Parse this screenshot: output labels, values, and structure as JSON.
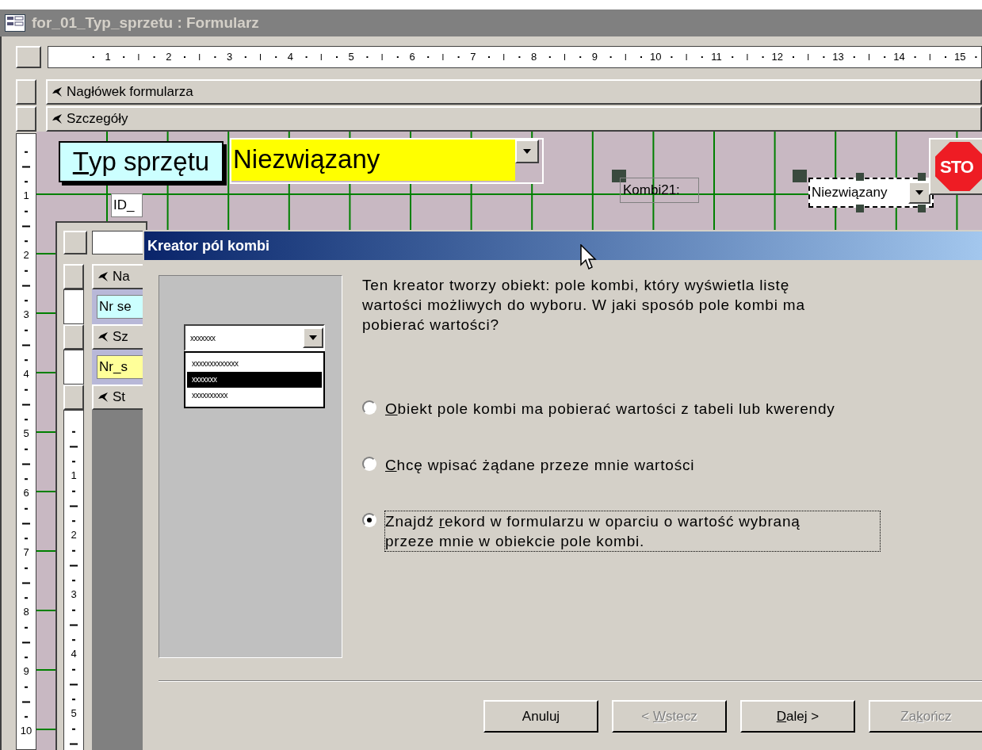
{
  "window": {
    "title": "for_01_Typ_sprzetu : Formularz"
  },
  "ruler": {
    "horizontal": [
      "1",
      "2",
      "3",
      "4",
      "5",
      "6",
      "7",
      "8",
      "9",
      "10",
      "11",
      "12",
      "13",
      "14",
      "15"
    ],
    "vertical": [
      "1",
      "2",
      "3",
      "4",
      "5",
      "6",
      "7",
      "8",
      "9",
      "10"
    ]
  },
  "sections": [
    {
      "label": "Nagłówek formularza"
    },
    {
      "label": "Szczegóły"
    }
  ],
  "detail": {
    "label": {
      "key": "T",
      "post": "yp sprzętu"
    },
    "combo": {
      "value": "Niezwiązany"
    },
    "id_field": "ID_",
    "kombi_label": "Kombi21:",
    "kombi_combo": {
      "value": "Niezwiązany",
      "selected": true
    },
    "stop_button": "STO"
  },
  "subform": {
    "ruler_vertical": [
      "1",
      "2",
      "3",
      "4",
      "5"
    ],
    "sections": [
      {
        "label": "Na",
        "field": {
          "text": "Nr se",
          "color": "#ccffff"
        }
      },
      {
        "label": "Sz",
        "field": {
          "text": "Nr_s",
          "color": "#ffff99"
        }
      },
      {
        "label": "St"
      }
    ]
  },
  "dialog": {
    "title": "Kreator pól kombi",
    "intro": "Ten kreator tworzy obiekt: pole kombi, który wyświetla listę wartości możliwych do wyboru. W jaki sposób pole kombi ma pobierać wartości?",
    "preview": {
      "value": "xxxxxxx",
      "items": [
        {
          "text": "xxxxxxxxxxxxx",
          "selected": false
        },
        {
          "text": "xxxxxxx",
          "selected": true
        },
        {
          "text": "xxxxxxxxxx",
          "selected": false
        }
      ]
    },
    "options": [
      {
        "key": "O",
        "post": "biekt pole kombi ma pobierać wartości z tabeli lub kwerendy",
        "selected": false,
        "focused": false
      },
      {
        "key": "C",
        "post": "hcę wpisać żądane przeze mnie wartości",
        "selected": false,
        "focused": false
      },
      {
        "pre": "Znajdź ",
        "key": "r",
        "post": "ekord w formularzu w oparciu o wartość wybraną przeze mnie w obiekcie pole kombi.",
        "selected": true,
        "focused": true
      }
    ],
    "buttons": [
      {
        "post": "Anuluj",
        "disabled": false
      },
      {
        "pre": "< ",
        "key": "W",
        "post": "stecz",
        "disabled": true
      },
      {
        "key": "D",
        "post": "alej >",
        "disabled": false
      },
      {
        "pre": "Za",
        "key": "k",
        "post": "ończ",
        "disabled": true
      }
    ]
  }
}
